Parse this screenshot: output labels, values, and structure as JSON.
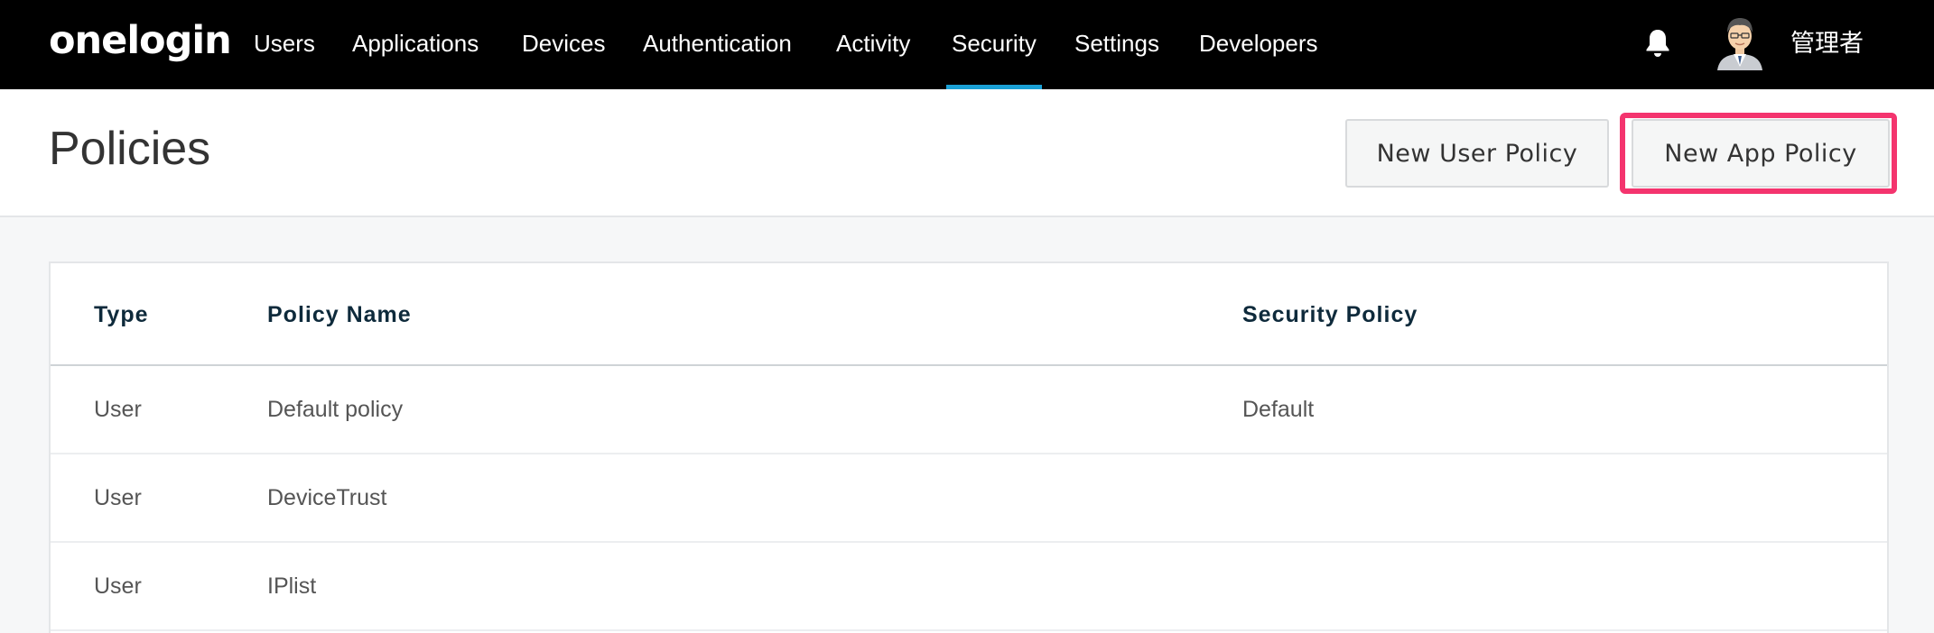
{
  "topbar": {
    "logo": "onelogin",
    "nav": [
      {
        "label": "Users",
        "name": "nav-users",
        "active": false
      },
      {
        "label": "Applications",
        "name": "nav-applications",
        "active": false
      },
      {
        "label": "Devices",
        "name": "nav-devices",
        "active": false
      },
      {
        "label": "Authentication",
        "name": "nav-authentication",
        "active": false
      },
      {
        "label": "Activity",
        "name": "nav-activity",
        "active": false
      },
      {
        "label": "Security",
        "name": "nav-security",
        "active": true
      },
      {
        "label": "Settings",
        "name": "nav-settings",
        "active": false
      },
      {
        "label": "Developers",
        "name": "nav-developers",
        "active": false
      }
    ],
    "user_name": "管理者",
    "icons": {
      "notifications": "bell-icon",
      "avatar": "user-avatar"
    }
  },
  "header": {
    "title": "Policies",
    "new_user_policy_label": "New User Policy",
    "new_app_policy_label": "New App Policy"
  },
  "table": {
    "columns": [
      "Type",
      "Policy Name",
      "Security Policy"
    ],
    "rows": [
      {
        "type": "User",
        "name": "Default policy",
        "security": "Default"
      },
      {
        "type": "User",
        "name": "DeviceTrust",
        "security": ""
      },
      {
        "type": "User",
        "name": "IPlist",
        "security": ""
      }
    ]
  },
  "colors": {
    "topbar_bg": "#000000",
    "active_tab_accent": "#1ba1d6",
    "highlight_border": "#f4346e",
    "page_bg": "#f6f7f8",
    "table_header_text": "#0e2a3b"
  }
}
